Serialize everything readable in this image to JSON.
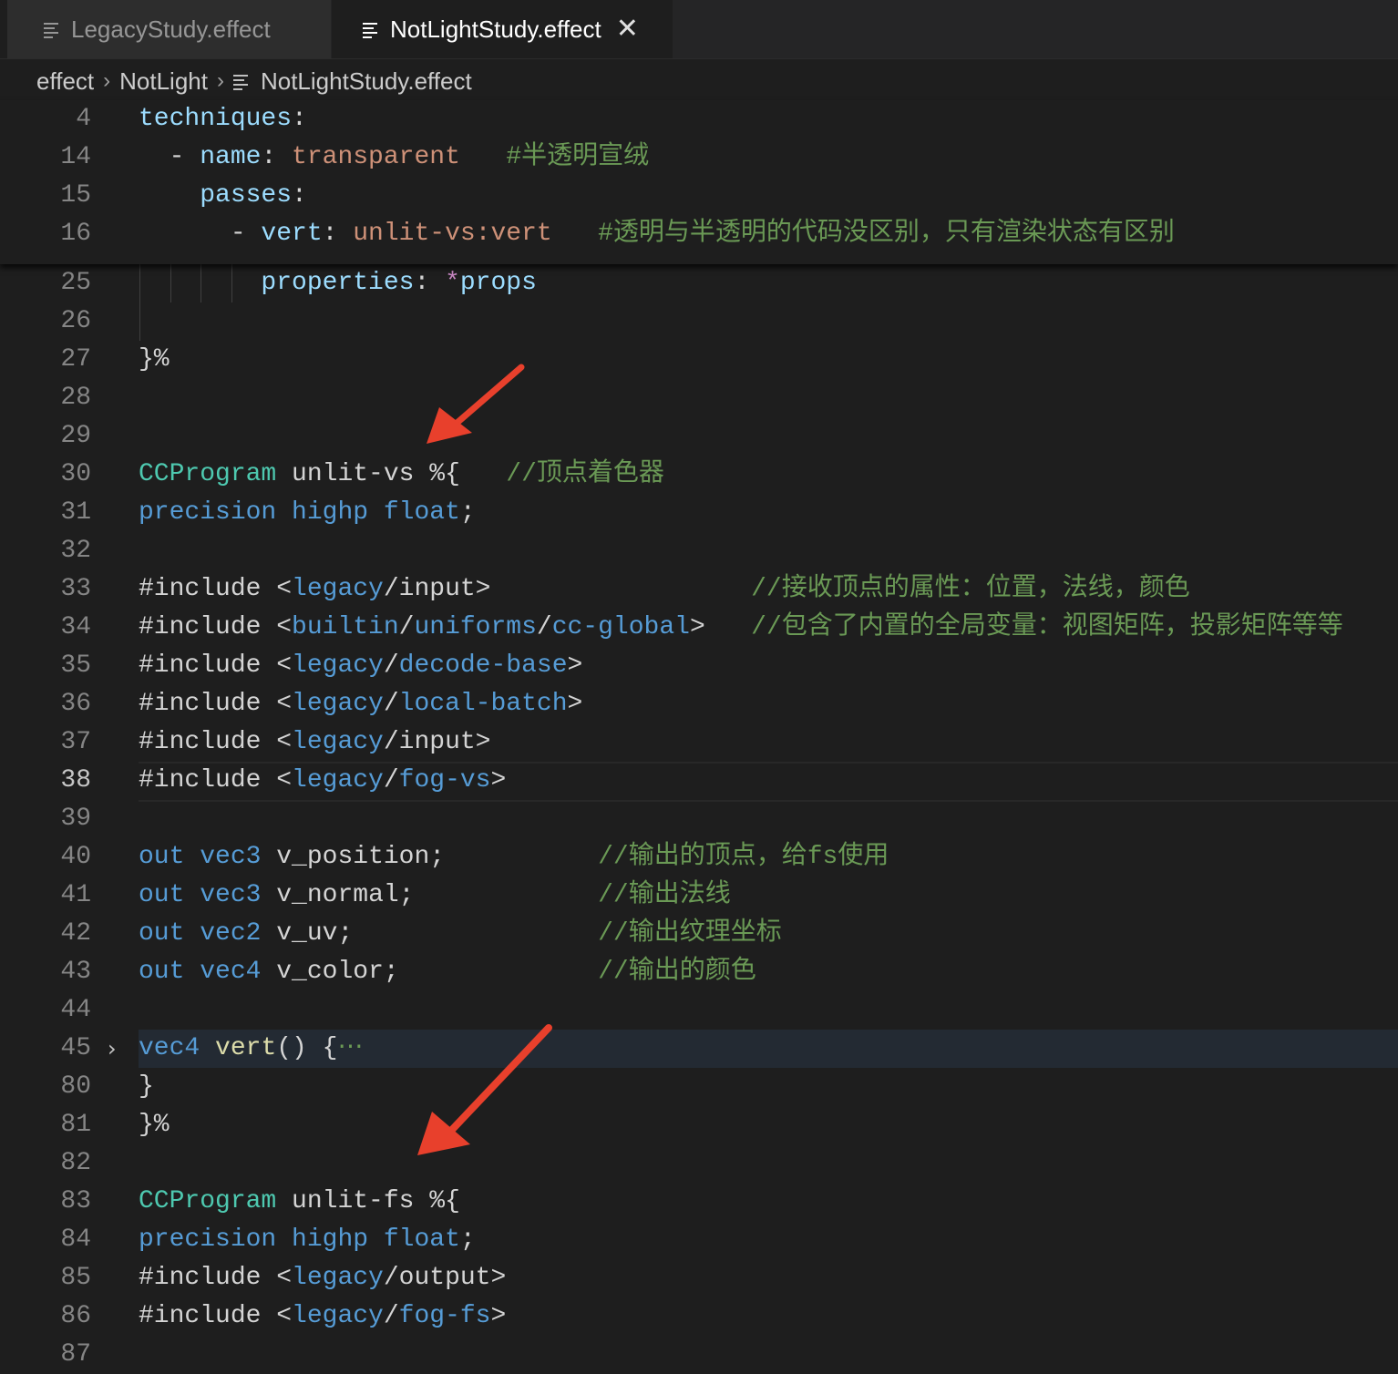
{
  "tabs": [
    {
      "label": "LegacyStudy.effect",
      "active": false
    },
    {
      "label": "NotLightStudy.effect",
      "active": true,
      "close": "✕"
    }
  ],
  "breadcrumb": {
    "items": [
      "effect",
      "NotLight",
      "NotLightStudy.effect"
    ],
    "separator": "›"
  },
  "sticky_lines": [
    {
      "n": "4",
      "segs": [
        [
          "t-var",
          "techniques"
        ],
        [
          "t-pl",
          ":"
        ]
      ]
    },
    {
      "n": "14",
      "segs": [
        [
          "t-pl",
          "  - "
        ],
        [
          "t-var",
          "name"
        ],
        [
          "t-pl",
          ": "
        ],
        [
          "t-str",
          "transparent"
        ],
        [
          "t-pl",
          "   "
        ],
        [
          "t-cmt",
          "#半透明宣绒"
        ]
      ]
    },
    {
      "n": "15",
      "segs": [
        [
          "t-pl",
          "    "
        ],
        [
          "t-var",
          "passes"
        ],
        [
          "t-pl",
          ":"
        ]
      ]
    },
    {
      "n": "16",
      "segs": [
        [
          "t-pl",
          "      - "
        ],
        [
          "t-var",
          "vert"
        ],
        [
          "t-pl",
          ": "
        ],
        [
          "t-str",
          "unlit-vs:vert"
        ],
        [
          "t-pl",
          "   "
        ],
        [
          "t-cmt",
          "#透明与半透明的代码没区别，只有渲染状态有区别"
        ]
      ]
    }
  ],
  "code_lines": [
    {
      "n": "25",
      "segs": [
        [
          "t-pl",
          "        "
        ],
        [
          "t-var",
          "properties"
        ],
        [
          "t-pl",
          ": "
        ],
        [
          "t-op",
          "*"
        ],
        [
          "t-var",
          "props"
        ]
      ]
    },
    {
      "n": "26",
      "segs": []
    },
    {
      "n": "27",
      "segs": [
        [
          "t-pl",
          "}%"
        ]
      ]
    },
    {
      "n": "28",
      "segs": []
    },
    {
      "n": "29",
      "segs": []
    },
    {
      "n": "30",
      "segs": [
        [
          "t-type",
          "CCProgram"
        ],
        [
          "t-pl",
          " unlit-vs %{   "
        ],
        [
          "t-cmt",
          "//顶点着色器"
        ]
      ]
    },
    {
      "n": "31",
      "segs": [
        [
          "t-key",
          "precision"
        ],
        [
          "t-pl",
          " "
        ],
        [
          "t-key",
          "highp"
        ],
        [
          "t-pl",
          " "
        ],
        [
          "t-key",
          "float"
        ],
        [
          "t-pl",
          ";"
        ]
      ]
    },
    {
      "n": "32",
      "segs": []
    },
    {
      "n": "33",
      "segs": [
        [
          "t-pl",
          "#include <"
        ],
        [
          "t-key",
          "legacy"
        ],
        [
          "t-pl",
          "/input>                 "
        ],
        [
          "t-cmt",
          "//接收顶点的属性：位置，法线，颜色"
        ]
      ]
    },
    {
      "n": "34",
      "segs": [
        [
          "t-pl",
          "#include <"
        ],
        [
          "t-key",
          "builtin"
        ],
        [
          "t-pl",
          "/"
        ],
        [
          "t-key",
          "uniforms"
        ],
        [
          "t-pl",
          "/"
        ],
        [
          "t-key",
          "cc-global"
        ],
        [
          "t-pl",
          ">   "
        ],
        [
          "t-cmt",
          "//包含了内置的全局变量：视图矩阵，投影矩阵等等"
        ]
      ]
    },
    {
      "n": "35",
      "segs": [
        [
          "t-pl",
          "#include <"
        ],
        [
          "t-key",
          "legacy"
        ],
        [
          "t-pl",
          "/"
        ],
        [
          "t-key",
          "decode-base"
        ],
        [
          "t-pl",
          ">"
        ]
      ]
    },
    {
      "n": "36",
      "segs": [
        [
          "t-pl",
          "#include <"
        ],
        [
          "t-key",
          "legacy"
        ],
        [
          "t-pl",
          "/"
        ],
        [
          "t-key",
          "local-batch"
        ],
        [
          "t-pl",
          ">"
        ]
      ]
    },
    {
      "n": "37",
      "segs": [
        [
          "t-pl",
          "#include <"
        ],
        [
          "t-key",
          "legacy"
        ],
        [
          "t-pl",
          "/input>"
        ]
      ]
    },
    {
      "n": "38",
      "segs": [
        [
          "t-pl",
          "#include <"
        ],
        [
          "t-key",
          "legacy"
        ],
        [
          "t-pl",
          "/"
        ],
        [
          "t-key",
          "fog-vs"
        ],
        [
          "t-pl",
          ">"
        ]
      ]
    },
    {
      "n": "39",
      "segs": []
    },
    {
      "n": "40",
      "segs": [
        [
          "t-key",
          "out"
        ],
        [
          "t-pl",
          " "
        ],
        [
          "t-key",
          "vec3"
        ],
        [
          "t-pl",
          " v_position;          "
        ],
        [
          "t-cmt",
          "//输出的顶点，给fs使用"
        ]
      ]
    },
    {
      "n": "41",
      "segs": [
        [
          "t-key",
          "out"
        ],
        [
          "t-pl",
          " "
        ],
        [
          "t-key",
          "vec3"
        ],
        [
          "t-pl",
          " v_normal;            "
        ],
        [
          "t-cmt",
          "//输出法线"
        ]
      ]
    },
    {
      "n": "42",
      "segs": [
        [
          "t-key",
          "out"
        ],
        [
          "t-pl",
          " "
        ],
        [
          "t-key",
          "vec2"
        ],
        [
          "t-pl",
          " v_uv;                "
        ],
        [
          "t-cmt",
          "//输出纹理坐标"
        ]
      ]
    },
    {
      "n": "43",
      "segs": [
        [
          "t-key",
          "out"
        ],
        [
          "t-pl",
          " "
        ],
        [
          "t-key",
          "vec4"
        ],
        [
          "t-pl",
          " v_color;             "
        ],
        [
          "t-cmt",
          "//输出的颜色"
        ]
      ]
    },
    {
      "n": "44",
      "segs": []
    },
    {
      "n": "45",
      "segs": [
        [
          "t-key",
          "vec4"
        ],
        [
          "t-pl",
          " "
        ],
        [
          "t-fn",
          "vert"
        ],
        [
          "t-pl",
          "() {"
        ],
        [
          "t-cmt",
          "⋯"
        ]
      ]
    },
    {
      "n": "80",
      "segs": [
        [
          "t-pl",
          "}"
        ]
      ]
    },
    {
      "n": "81",
      "segs": [
        [
          "t-pl",
          "}%"
        ]
      ]
    },
    {
      "n": "82",
      "segs": []
    },
    {
      "n": "83",
      "segs": [
        [
          "t-type",
          "CCProgram"
        ],
        [
          "t-pl",
          " unlit-fs %{"
        ]
      ]
    },
    {
      "n": "84",
      "segs": [
        [
          "t-key",
          "precision"
        ],
        [
          "t-pl",
          " "
        ],
        [
          "t-key",
          "highp"
        ],
        [
          "t-pl",
          " "
        ],
        [
          "t-key",
          "float"
        ],
        [
          "t-pl",
          ";"
        ]
      ]
    },
    {
      "n": "85",
      "segs": [
        [
          "t-pl",
          "#include <"
        ],
        [
          "t-key",
          "legacy"
        ],
        [
          "t-pl",
          "/output>"
        ]
      ]
    },
    {
      "n": "86",
      "segs": [
        [
          "t-pl",
          "#include <"
        ],
        [
          "t-key",
          "legacy"
        ],
        [
          "t-pl",
          "/"
        ],
        [
          "t-key",
          "fog-fs"
        ],
        [
          "t-pl",
          ">"
        ]
      ]
    },
    {
      "n": "87",
      "segs": []
    }
  ],
  "current_line": "38",
  "folded_line": "45",
  "colors": {
    "background": "#1e1e1e",
    "annotation_arrow": "#e8402c"
  }
}
